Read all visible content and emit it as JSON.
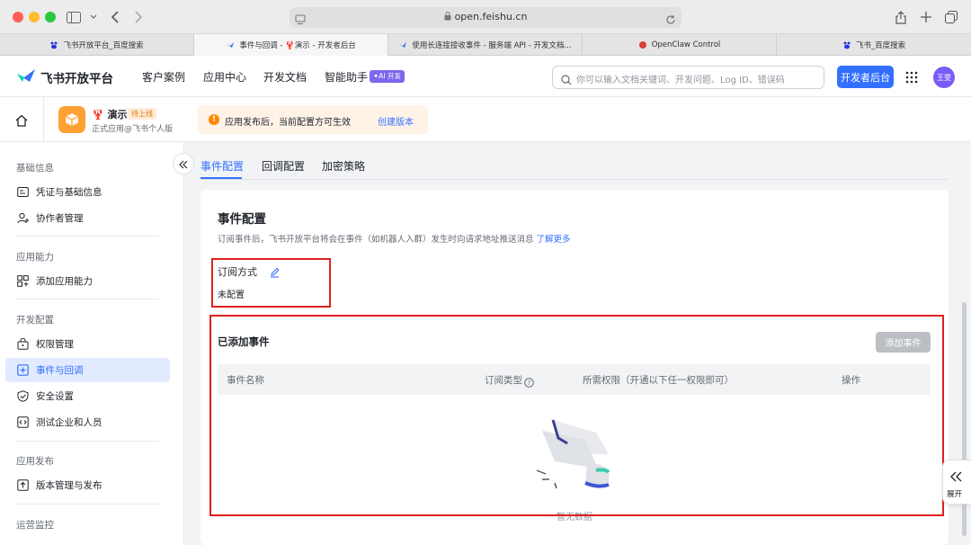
{
  "browser": {
    "url": "open.feishu.cn",
    "tabs": [
      {
        "title": "飞书开放平台_百度搜索"
      },
      {
        "title": "事件与回调 - 🦞演示 - 开发者后台"
      },
      {
        "title": "使用长连接接收事件 - 服务端 API - 开发文档..."
      },
      {
        "title": "OpenClaw Control"
      },
      {
        "title": "飞书_百度搜索"
      }
    ]
  },
  "header": {
    "logo_text": "飞书开放平台",
    "nav": [
      "客户案例",
      "应用中心",
      "开发文档",
      "智能助手"
    ],
    "ai_badge": "✦AI 开发",
    "search_placeholder": "你可以输入文档关键词、开发问题、Log ID、错误码",
    "dev_button": "开发者后台",
    "avatar": "王雯"
  },
  "app": {
    "name": "🦞 演示",
    "status_badge": "待上线",
    "subtitle": "正式应用@飞书个人版",
    "notice": "应用发布后，当前配置方可生效",
    "notice_link": "创建版本"
  },
  "sidebar": {
    "sections": [
      {
        "title": "基础信息",
        "items": [
          "凭证与基础信息",
          "协作者管理"
        ]
      },
      {
        "title": "应用能力",
        "items": [
          "添加应用能力"
        ]
      },
      {
        "title": "开发配置",
        "items": [
          "权限管理",
          "事件与回调",
          "安全设置",
          "测试企业和人员"
        ]
      },
      {
        "title": "应用发布",
        "items": [
          "版本管理与发布"
        ]
      },
      {
        "title": "运营监控",
        "items": []
      }
    ],
    "active_item": "事件与回调"
  },
  "main": {
    "tabs": [
      "事件配置",
      "回调配置",
      "加密策略"
    ],
    "active_tab": "事件配置",
    "card": {
      "title": "事件配置",
      "desc": "订阅事件后，飞书开放平台将会在事件（如机器人入群）发生时向请求地址推送消息",
      "desc_link": "了解更多",
      "subscribe_label": "订阅方式",
      "subscribe_value": "未配置",
      "added_title": "已添加事件",
      "add_button": "添加事件",
      "columns": [
        "事件名称",
        "订阅类型",
        "所需权限（开通以下任一权限即可）",
        "操作"
      ],
      "empty_text": "暂无数据"
    }
  },
  "float_button": {
    "label": "展开"
  },
  "colors": {
    "accent": "#3370ff",
    "annotation_red": "#e02020",
    "notice_bg": "#fff3e8"
  }
}
